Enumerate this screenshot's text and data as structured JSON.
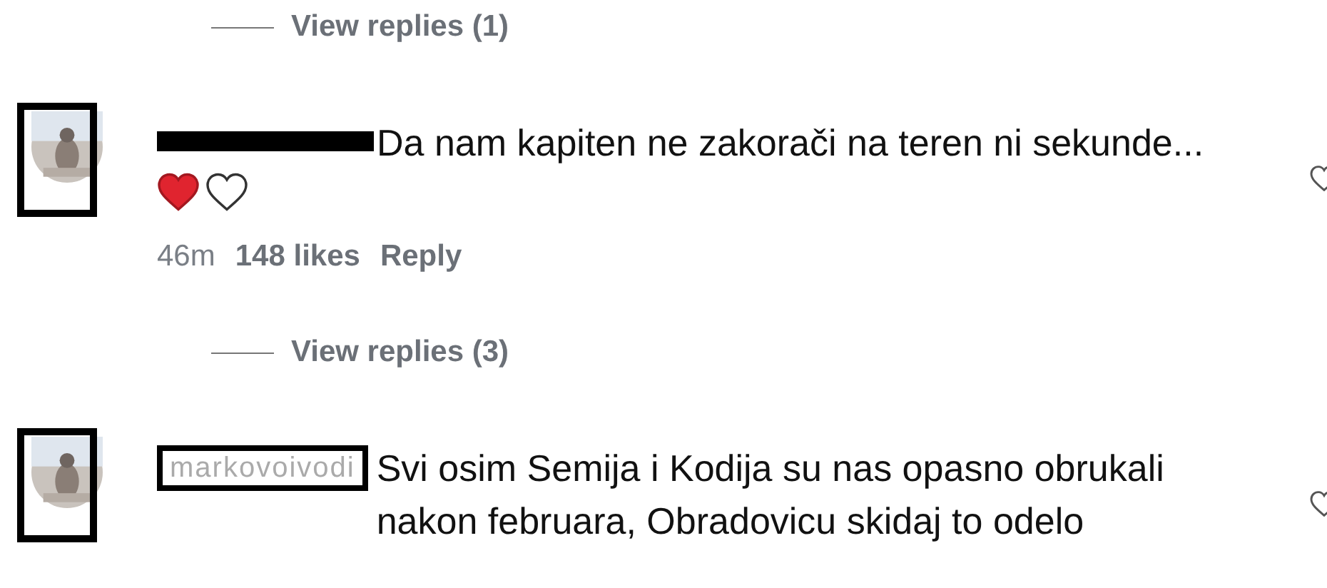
{
  "threads": [
    {
      "view_replies": "View replies (1)",
      "comment": {
        "text": "Da nam kapiten ne zakorači na teren ni sekunde...",
        "reactions": [
          {
            "liked": true
          },
          {
            "liked": false
          }
        ],
        "time": "46m",
        "likes": "148 likes",
        "reply": "Reply"
      }
    },
    {
      "view_replies": "View replies (3)",
      "comment": {
        "username": "markovoivodi",
        "text": "Svi osim Semija i Kodija su nas opasno obrukali nakon februara, Obradovicu skidaj to odelo"
      }
    }
  ]
}
